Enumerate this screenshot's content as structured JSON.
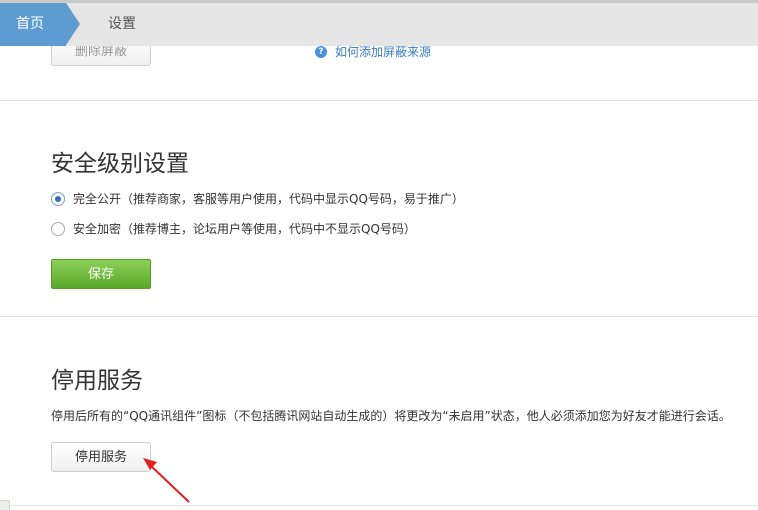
{
  "breadcrumb": {
    "home": "首页",
    "current": "设置"
  },
  "blocking": {
    "remove_button": "删除屏蔽",
    "help_link": "如何添加屏蔽来源"
  },
  "security": {
    "title": "安全级别设置",
    "options": [
      {
        "label": "完全公开（推荐商家，客服等用户使用，代码中显示QQ号码，易于推广）",
        "selected": true
      },
      {
        "label": "安全加密（推荐博主，论坛用户等使用，代码中不显示QQ号码）",
        "selected": false
      }
    ],
    "save_button": "保存"
  },
  "disable_service": {
    "title": "停用服务",
    "description": "停用后所有的“QQ通讯组件”图标（不包括腾讯网站自动生成的）将更改为“未启用”状态，他人必须添加您为好友才能进行会话。",
    "button": "停用服务"
  },
  "colors": {
    "breadcrumb_active": "#5d9bd1",
    "save_green": "#5aa82b",
    "annotation_arrow": "#e02020",
    "link_blue": "#3a7cc2"
  }
}
